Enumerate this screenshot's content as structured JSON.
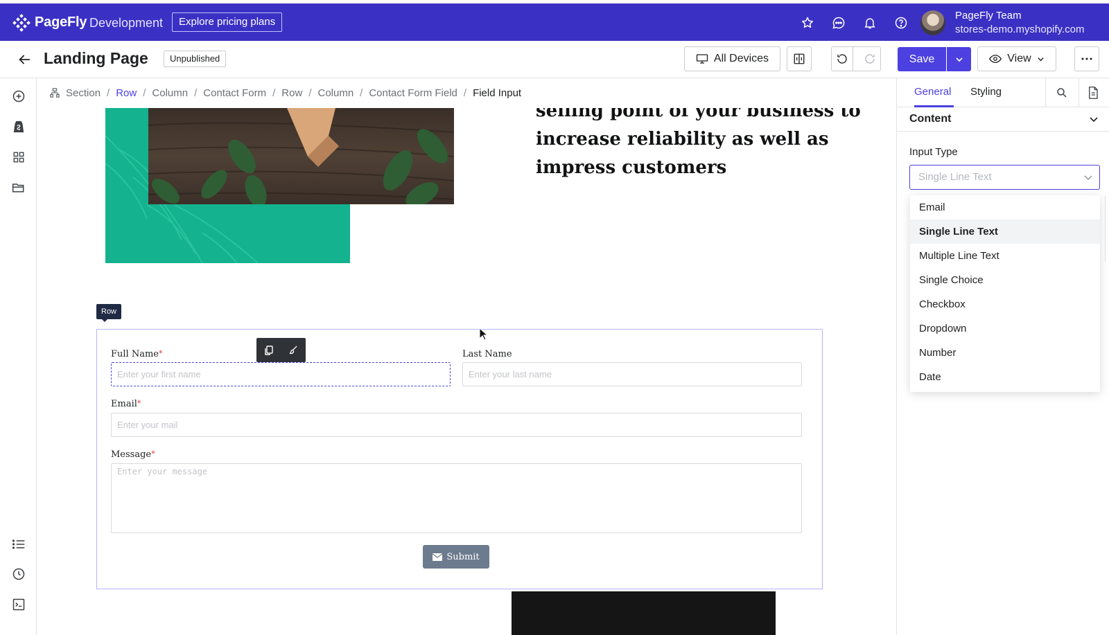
{
  "colors": {
    "brand": "#3b30c4",
    "accent": "#4c40e0",
    "teal": "#14b28e",
    "required": "#e03a3a",
    "submit": "#6d7b8f"
  },
  "topbar": {
    "brand": "PageFly",
    "brand_sub": "Development",
    "pricing_label": "Explore pricing plans",
    "icons": [
      "star-icon",
      "chat-icon",
      "bell-icon",
      "help-icon"
    ],
    "team_name": "PageFly Team",
    "store": "stores-demo.myshopify.com"
  },
  "header": {
    "title": "Landing Page",
    "status": "Unpublished",
    "devices_label": "All Devices",
    "save_label": "Save",
    "view_label": "View"
  },
  "left_rail": {
    "icons": [
      "add-icon",
      "shopify-icon",
      "grid-icon",
      "folder-icon",
      "list-icon",
      "history-icon",
      "console-icon"
    ]
  },
  "breadcrumb": {
    "items": [
      "Section",
      "Row",
      "Column",
      "Contact Form",
      "Row",
      "Column",
      "Contact Form Field",
      "Field Input"
    ]
  },
  "canvas": {
    "headline": "selling point of your business to increase reliability as well as impress customers",
    "row_tag": "Row",
    "form": {
      "full_name_label": "Full Name",
      "full_name_placeholder": "Enter your first name",
      "last_name_label": "Last Name",
      "last_name_placeholder": "Enter your last name",
      "email_label": "Email",
      "email_placeholder": "Enter your mail",
      "message_label": "Message",
      "message_placeholder": "Enter your message",
      "required_mark": "*",
      "submit_label": "Submit"
    }
  },
  "right_panel": {
    "tabs": [
      "General",
      "Styling"
    ],
    "active_tab": "General",
    "section_title": "Content",
    "input_type_label": "Input Type",
    "input_type_value": "Single Line Text",
    "options": [
      "Email",
      "Single Line Text",
      "Multiple Line Text",
      "Single Choice",
      "Checkbox",
      "Dropdown",
      "Number",
      "Date"
    ],
    "selected_option": "Single Line Text"
  }
}
